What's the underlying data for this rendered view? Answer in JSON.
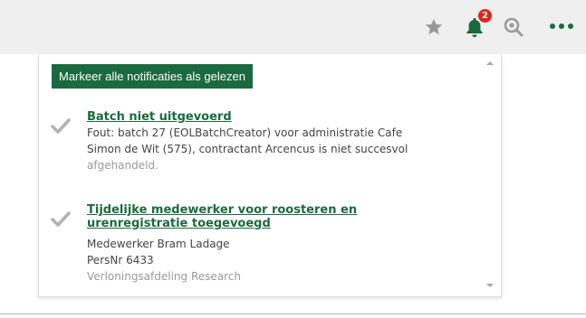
{
  "header": {
    "icons": [
      "star-icon",
      "bell-icon",
      "search-icon",
      "more-icon"
    ],
    "notification_count": "2",
    "accent_color": "#1b6a3f",
    "badge_color": "#e2231a"
  },
  "panel": {
    "mark_all_label": "Markeer alle notificaties als gelezen",
    "notifications": [
      {
        "title": "Batch niet uitgevoerd",
        "lines": [
          "Fout: batch 27 (EOLBatchCreator) voor administratie Cafe",
          "Simon de Wit (575), contractant Arcencus is niet succesvol",
          "afgehandeld."
        ]
      },
      {
        "title_lines": [
          "Tijdelijke medewerker voor roosteren en",
          "urenregistratie toegevoegd"
        ],
        "lines": [
          "Medewerker Bram Ladage",
          "PersNr 6433",
          "Verloningsafdeling Research"
        ]
      }
    ]
  }
}
